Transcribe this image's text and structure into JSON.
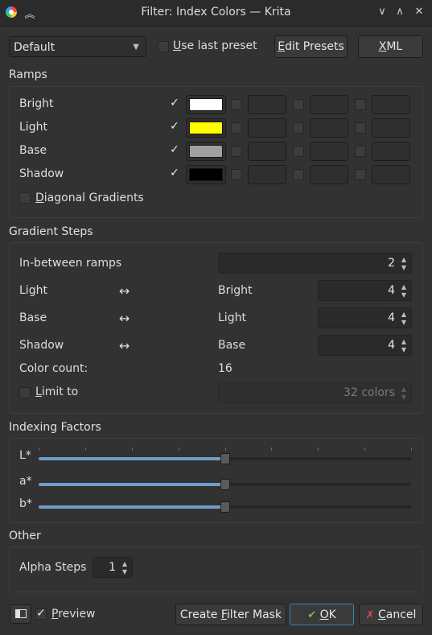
{
  "window": {
    "title": "Filter: Index Colors — Krita"
  },
  "top_bar": {
    "preset_select": "Default",
    "use_last_preset_pre": "",
    "use_last_preset_u": "U",
    "use_last_preset_post": "se last preset",
    "edit_presets_u": "E",
    "edit_presets_post": "dit Presets",
    "xml_u": "X",
    "xml_post": "ML"
  },
  "ramps": {
    "title": "Ramps",
    "rows": [
      {
        "label": "Bright",
        "enabled": true,
        "color": "#ffffff"
      },
      {
        "label": "Light",
        "enabled": true,
        "color": "#ffff00"
      },
      {
        "label": "Base",
        "enabled": true,
        "color": "#a0a0a0"
      },
      {
        "label": "Shadow",
        "enabled": true,
        "color": "#000000"
      }
    ],
    "diagonal_u": "D",
    "diagonal_post": "iagonal Gradients"
  },
  "gradient_steps": {
    "title": "Gradient Steps",
    "in_between_label": "In-between ramps",
    "in_between_value": "2",
    "arrow": "↔",
    "rows": [
      {
        "from": "Light",
        "to": "Bright",
        "value": "4"
      },
      {
        "from": "Base",
        "to": "Light",
        "value": "4"
      },
      {
        "from": "Shadow",
        "to": "Base",
        "value": "4"
      }
    ],
    "color_count_label": "Color count:",
    "color_count_value": "16",
    "limit_u": "L",
    "limit_post": "imit to",
    "limit_value": "32 colors"
  },
  "indexing": {
    "title": "Indexing Factors",
    "sliders": [
      {
        "label": "L*",
        "value": 0.5
      },
      {
        "label": "a*",
        "value": 0.5
      },
      {
        "label": "b*",
        "value": 0.5
      }
    ]
  },
  "other": {
    "title": "Other",
    "alpha_steps_label": "Alpha Steps",
    "alpha_steps_value": "1"
  },
  "bottom": {
    "preview_u": "P",
    "preview_post": "review",
    "create_mask_pre": "Create ",
    "create_mask_u": "F",
    "create_mask_post": "ilter Mask",
    "ok_u": "O",
    "ok_post": "K",
    "cancel_u": "C",
    "cancel_post": "ancel"
  },
  "check_glyph": "✓"
}
